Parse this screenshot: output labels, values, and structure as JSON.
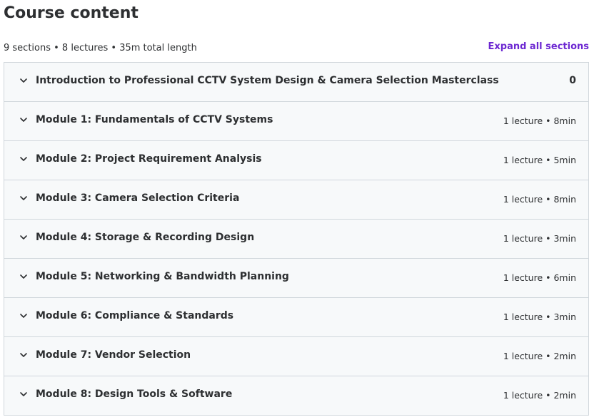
{
  "header": {
    "title": "Course content",
    "summary": "9 sections • 8 lectures • 35m total length",
    "expand_all_label": "Expand all sections"
  },
  "colors": {
    "accent": "#6d28d2",
    "section_bg": "#f7f9fa",
    "border": "#d1d7dc",
    "text": "#2d2f31"
  },
  "sections": [
    {
      "title": "Introduction to Professional CCTV System Design & Camera Selection Masterclass",
      "meta": "0",
      "icon": "chevron-down-icon"
    },
    {
      "title": "Module 1: Fundamentals of CCTV Systems",
      "meta": "1 lecture • 8min",
      "icon": "chevron-down-icon"
    },
    {
      "title": "Module 2: Project Requirement Analysis",
      "meta": "1 lecture • 5min",
      "icon": "chevron-down-icon"
    },
    {
      "title": "Module 3: Camera Selection Criteria",
      "meta": "1 lecture • 8min",
      "icon": "chevron-down-icon"
    },
    {
      "title": "Module 4: Storage & Recording Design",
      "meta": "1 lecture • 3min",
      "icon": "chevron-down-icon"
    },
    {
      "title": "Module 5: Networking & Bandwidth Planning",
      "meta": "1 lecture • 6min",
      "icon": "chevron-down-icon"
    },
    {
      "title": "Module 6: Compliance & Standards",
      "meta": "1 lecture • 3min",
      "icon": "chevron-down-icon"
    },
    {
      "title": "Module 7: Vendor Selection",
      "meta": "1 lecture • 2min",
      "icon": "chevron-down-icon"
    },
    {
      "title": "Module 8: Design Tools & Software",
      "meta": "1 lecture • 2min",
      "icon": "chevron-down-icon"
    }
  ]
}
